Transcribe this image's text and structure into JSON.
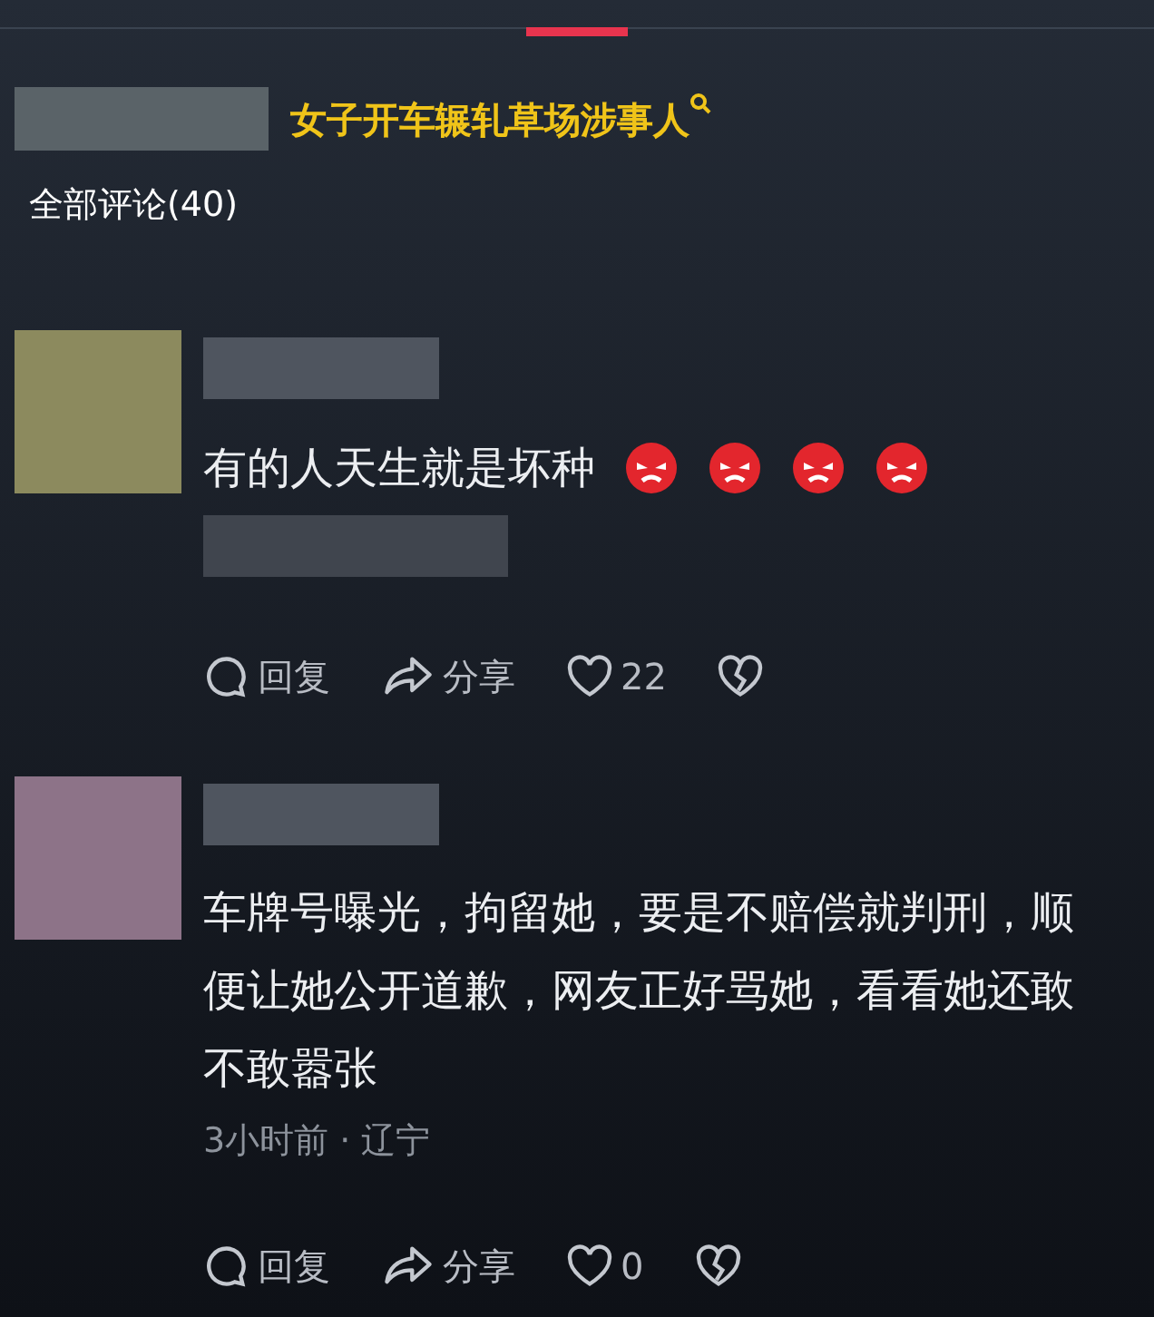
{
  "search_suggestion": {
    "label": "女子开车辗轧草场涉事人"
  },
  "comments_header": {
    "title": "全部评论(40)"
  },
  "comments": [
    {
      "kind": "emoji-text",
      "text": "有的人天生就是坏种",
      "color": "#8c8a5e",
      "liked": false,
      "actions": {
        "reply": "回复",
        "share": "分享",
        "likes": "22"
      }
    },
    {
      "kind": "text",
      "text": "车牌号曝光，拘留她，要是不赔偿就判刑，顺便让她公开道歉，网友正好骂她，看看她还敢不敢嚣张",
      "meta": "3小时前 · 辽宁",
      "color": "#8d7388",
      "liked": false,
      "actions": {
        "reply": "回复",
        "share": "分享",
        "likes": "0"
      }
    }
  ]
}
